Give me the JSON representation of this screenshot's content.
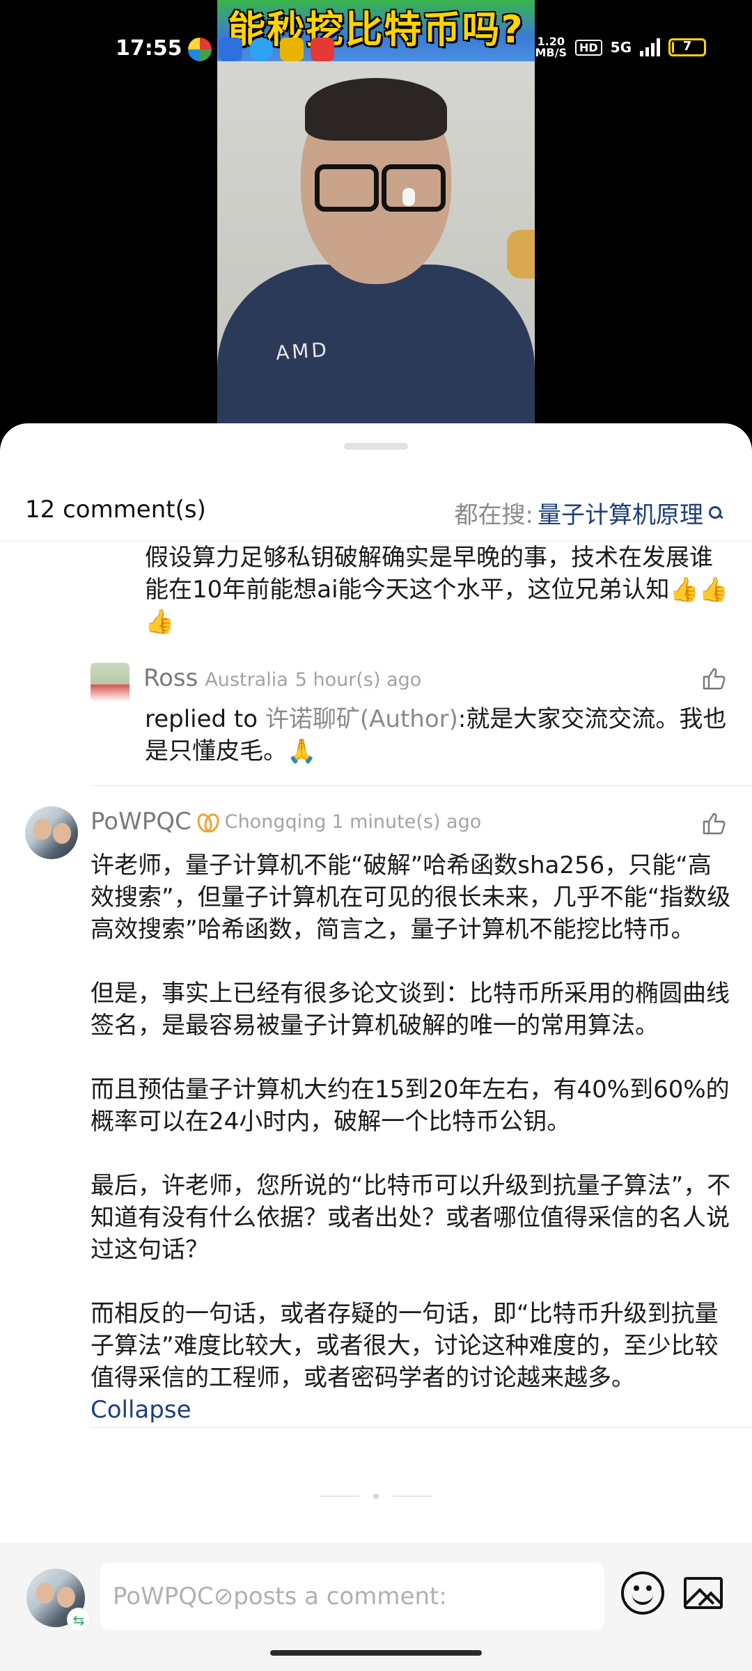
{
  "status_bar": {
    "time": "17:55",
    "net_speed_value": "1.20",
    "net_speed_unit": "MB/S",
    "hd_label": "HD",
    "network_type": "5G",
    "battery_level": "7"
  },
  "video": {
    "title_overlay": "能秒挖比特币吗?",
    "shirt_text": "AMD"
  },
  "header": {
    "comment_count": "12 comment(s)",
    "search_prefix": "都在搜:",
    "search_term": "量子计算机原理"
  },
  "previous_comment_tail": {
    "text": "假设算力足够私钥破解确实是早晚的事，技术在发展谁能在10年前能想ai能今天这个水平，这位兄弟认知👍👍👍"
  },
  "reply": {
    "name": "Ross",
    "location": "Australia",
    "time": "5 hour(s) ago",
    "prefix": " replied to ",
    "author": "许诺聊矿(Author)",
    "text": ":就是大家交流交流。我也是只懂皮毛。🙏"
  },
  "main_comment": {
    "name": "PoWPQC",
    "location": "Chongqing",
    "time": "1 minute(s) ago",
    "paragraphs": [
      "许老师，量子计算机不能“破解”哈希函数sha256，只能“高效搜索”，但量子计算机在可见的很长未来，几乎不能“指数级高效搜索”哈希函数，简言之，量子计算机不能挖比特币。",
      "但是，事实上已经有很多论文谈到：比特币所采用的椭圆曲线签名，是最容易被量子计算机破解的唯一的常用算法。",
      "而且预估量子计算机大约在15到20年左右，有40%到60%的概率可以在24小时内，破解一个比特币公钥。",
      "最后，许老师，您所说的“比特币可以升级到抗量子算法”，不知道有没有什么依据？或者出处？或者哪位值得采信的名人说过这句话？",
      "而相反的一句话，或者存疑的一句话，即“比特币升级到抗量子算法”难度比较大，或者很大，讨论这种难度的，至少比较值得采信的工程师，或者密码学者的讨论越来越多。"
    ],
    "collapse_label": "Collapse"
  },
  "input_bar": {
    "placeholder": "PoWPQC⊘posts a comment:",
    "switch_glyph": "⇆"
  },
  "colors": {
    "link": "#1d3e7a",
    "meta_gray": "#a3a3a3",
    "badge_orange": "#f0a030"
  }
}
